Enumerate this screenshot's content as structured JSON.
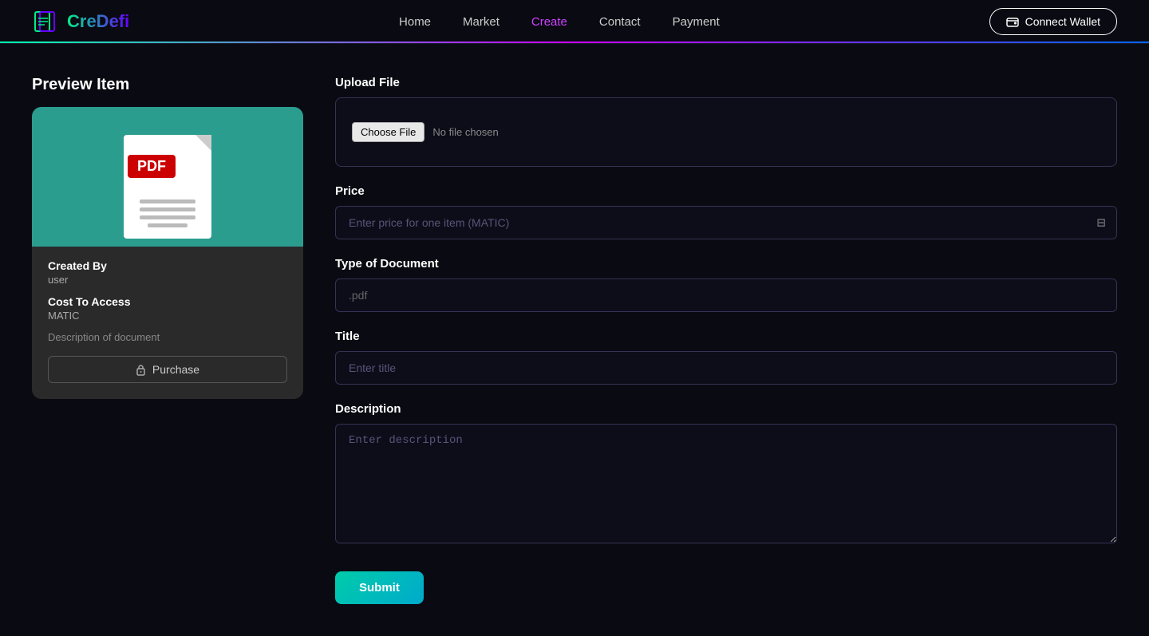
{
  "header": {
    "logo_text": "CreDefi",
    "nav": [
      {
        "label": "Home",
        "active": false
      },
      {
        "label": "Market",
        "active": false
      },
      {
        "label": "Create",
        "active": true
      },
      {
        "label": "Contact",
        "active": false
      },
      {
        "label": "Payment",
        "active": false
      }
    ],
    "connect_wallet_label": "Connect Wallet"
  },
  "preview": {
    "section_title": "Preview Item",
    "card": {
      "pdf_badge": "PDF",
      "created_by_label": "Created By",
      "created_by_value": "user",
      "cost_label": "Cost To Access",
      "cost_value": "MATIC",
      "description": "Description of document",
      "purchase_btn": "Purchase"
    }
  },
  "form": {
    "upload_label": "Upload File",
    "choose_file_btn": "Choose File",
    "no_file_text": "No file chosen",
    "price_label": "Price",
    "price_placeholder": "Enter price for one item (MATIC)",
    "doc_type_label": "Type of Document",
    "doc_type_value": ".pdf",
    "title_label": "Title",
    "title_placeholder": "Enter title",
    "description_label": "Description",
    "description_placeholder": "Enter description",
    "submit_btn": "Submit"
  }
}
